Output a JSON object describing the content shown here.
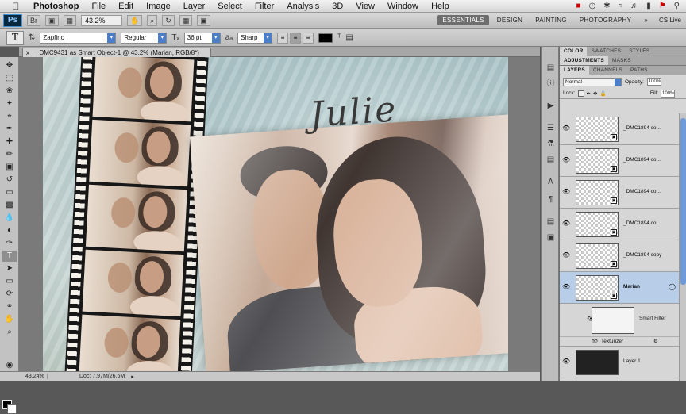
{
  "menubar": {
    "items": [
      "Photoshop",
      "File",
      "Edit",
      "Image",
      "Layer",
      "Select",
      "Filter",
      "Analysis",
      "3D",
      "View",
      "Window",
      "Help"
    ]
  },
  "appbar": {
    "badge": "Ps",
    "zoom": "43.2%",
    "workspaces": [
      "ESSENTIALS",
      "DESIGN",
      "PAINTING",
      "PHOTOGRAPHY"
    ],
    "active_workspace": "ESSENTIALS",
    "cs_live": "CS Live"
  },
  "options": {
    "tool": "T",
    "font_family": "Zapfino",
    "font_style": "Regular",
    "font_size": "36 pt",
    "antialias": "Sharp",
    "text_color": "#000000"
  },
  "document": {
    "tab_title": "_DMC9431 as Smart Object-1 @ 43.2% (Marian, RGB/8*)",
    "close": "x",
    "overlay_text": "Julie"
  },
  "status": {
    "zoom": "43.24%",
    "doc": "Doc: 7.97M/26.6M"
  },
  "panels": {
    "top_tabs": [
      "COLOR",
      "SWATCHES",
      "STYLES"
    ],
    "mid_tabs": [
      "ADJUSTMENTS",
      "MASKS"
    ],
    "layer_tabs": [
      "LAYERS",
      "CHANNELS",
      "PATHS"
    ],
    "blend_mode": "Normal",
    "opacity_label": "Opacity:",
    "opacity": "100%",
    "lock_label": "Lock:",
    "fill_label": "Fill:",
    "fill": "100%"
  },
  "layers": [
    {
      "name": "_DMC1894 co...",
      "selected": false
    },
    {
      "name": "_DMC1894 co...",
      "selected": false
    },
    {
      "name": "_DMC1894 co...",
      "selected": false
    },
    {
      "name": "_DMC1894 co...",
      "selected": false
    },
    {
      "name": "_DMC1894 copy",
      "selected": false
    },
    {
      "name": "Marian",
      "selected": true
    }
  ],
  "smart_filters": {
    "label": "Smart Filter",
    "filter": "Texturizer"
  },
  "last_layer": "Layer 1"
}
